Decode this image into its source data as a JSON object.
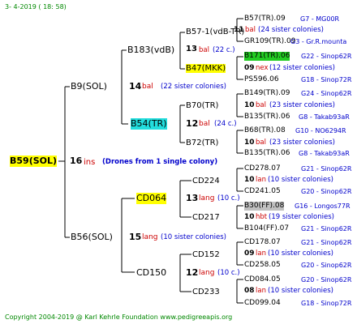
{
  "header": {
    "date_text": "3-  4-2019 ( 18: 58)"
  },
  "footer": {
    "copyright": "Copyright 2004-2019 @ Karl Kehrle Foundation    www.pedigreeapis.org"
  },
  "root": {
    "id": "B59(SOL)",
    "num": "16",
    "suffix": "ins",
    "note": "(Drones from 1 single colony)"
  },
  "gen1": [
    {
      "id": "B9(SOL)",
      "num": "14",
      "suffix": "bal",
      "note": "(22 sister colonies)"
    },
    {
      "id": "B56(SOL)",
      "num": "15",
      "suffix": "lang",
      "note": "(10 sister colonies)"
    }
  ],
  "gen2": [
    {
      "id": "B183(vdB)",
      "num": "",
      "suffix": "",
      "note": ""
    },
    {
      "id": "B54(TR)",
      "num": "12",
      "suffix": "bal",
      "note": "(24 c.)"
    },
    {
      "id": "CD064",
      "num": "13",
      "suffix": "lang",
      "note": "(10 c.)"
    },
    {
      "id": "CD150",
      "num": "12",
      "suffix": "lang",
      "note": "(10 c.)"
    }
  ],
  "gen3": [
    {
      "id": "B57-1(vdB-TR)",
      "num": "",
      "suffix": "",
      "note": ""
    },
    {
      "id": "B47(MKK)",
      "num": "13",
      "suffix": "bal",
      "note": "(22 c.)"
    },
    {
      "id": "B70(TR)",
      "num": "",
      "suffix": "",
      "note": ""
    },
    {
      "id": "B72(TR)",
      "num": "12",
      "suffix": "bal",
      "note": "(24 c.)"
    },
    {
      "id": "CD224",
      "num": "",
      "suffix": "",
      "note": ""
    },
    {
      "id": "CD217",
      "num": "13",
      "suffix": "lang",
      "note": "(10 c.)"
    },
    {
      "id": "CD152",
      "num": "",
      "suffix": "",
      "note": ""
    },
    {
      "id": "CD233",
      "num": "12",
      "suffix": "lang",
      "note": "(10 c.)"
    }
  ],
  "gen4": [
    {
      "id": "B57(TR).09",
      "ref": "G7 - MG00R"
    },
    {
      "num": "11",
      "suffix": "bal",
      "note": "(24 sister colonies)"
    },
    {
      "id": "GR109(TR).09",
      "ref": "G3 - Gr.R.mounta"
    },
    {
      "id": "B171(TR).06",
      "ref": "G22 - Sinop62R"
    },
    {
      "num": "09",
      "suffix": "nex",
      "note": "(12 sister colonies)"
    },
    {
      "id": "PS596.06",
      "ref": "G18 - Sinop72R"
    },
    {
      "id": "B149(TR).09",
      "ref": "G24 - Sinop62R"
    },
    {
      "num": "10",
      "suffix": "bal",
      "note": "(23 sister colonies)"
    },
    {
      "id": "B135(TR).06",
      "ref": "G8 - Takab93aR"
    },
    {
      "id": "B68(TR).08",
      "ref": "G10 - NO6294R"
    },
    {
      "num": "10",
      "suffix": "bal",
      "note": "(23 sister colonies)"
    },
    {
      "id": "B135(TR).06",
      "ref": "G8 - Takab93aR"
    },
    {
      "id": "CD278.07",
      "ref": "G21 - Sinop62R"
    },
    {
      "num": "10",
      "suffix": "lan",
      "note": "(10 sister colonies)"
    },
    {
      "id": "CD241.05",
      "ref": "G20 - Sinop62R"
    },
    {
      "id": "B30(FF).08",
      "ref": "G16 - Longos77R"
    },
    {
      "num": "10",
      "suffix": "hbt",
      "note": "(19 sister colonies)"
    },
    {
      "id": "B104(FF).07",
      "ref": "G21 - Sinop62R"
    },
    {
      "id": "CD178.07",
      "ref": "G21 - Sinop62R"
    },
    {
      "num": "09",
      "suffix": "lan",
      "note": "(10 sister colonies)"
    },
    {
      "id": "CD258.05",
      "ref": "G20 - Sinop62R"
    },
    {
      "id": "CD084.05",
      "ref": "G20 - Sinop62R"
    },
    {
      "num": "08",
      "suffix": "lan",
      "note": "(10 sister colonies)"
    },
    {
      "id": "CD099.04",
      "ref": "G18 - Sinop72R"
    }
  ],
  "colors": {
    "blue": "#0000cc",
    "red": "#cc0000",
    "green": "#008800",
    "yellow": "#ffff00",
    "cyan": "#22dddd",
    "lime": "#22cc22",
    "gray": "#c0c0c0"
  }
}
